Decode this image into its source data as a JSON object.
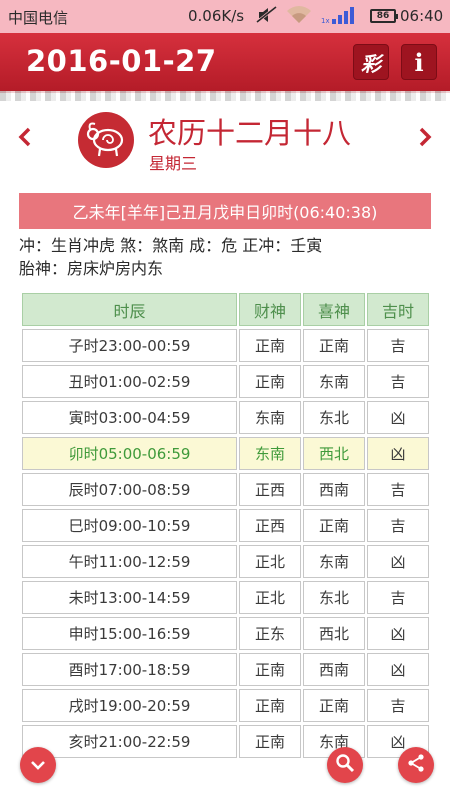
{
  "status": {
    "carrier": "中国电信",
    "speed": "0.06K/s",
    "battery": "86",
    "time": "06:40"
  },
  "header": {
    "date": "2016-01-27",
    "lottery_label": "彩",
    "info_label": "i"
  },
  "lunar": {
    "date": "农历十二月十八",
    "weekday": "星期三",
    "zodiac_icon": "goat-icon",
    "ganzhi": "乙未年[羊年]己丑月戊申日卯时(06:40:38)",
    "line1": "冲：生肖冲虎  煞：煞南  成：危  正冲：壬寅",
    "line2": "胎神：房床炉房内东"
  },
  "colors": {
    "accent": "#c42734",
    "good": "#3f9a3a"
  },
  "table": {
    "headers": [
      "时辰",
      "财神",
      "喜神",
      "吉时"
    ],
    "rows": [
      {
        "time": "子时23:00-00:59",
        "cai": "正南",
        "xi": "正南",
        "ji": "吉"
      },
      {
        "time": "丑时01:00-02:59",
        "cai": "正南",
        "xi": "东南",
        "ji": "吉"
      },
      {
        "time": "寅时03:00-04:59",
        "cai": "东南",
        "xi": "东北",
        "ji": "凶"
      },
      {
        "time": "卯时05:00-06:59",
        "cai": "东南",
        "xi": "西北",
        "ji": "凶"
      },
      {
        "time": "辰时07:00-08:59",
        "cai": "正西",
        "xi": "西南",
        "ji": "吉"
      },
      {
        "time": "巳时09:00-10:59",
        "cai": "正西",
        "xi": "正南",
        "ji": "吉"
      },
      {
        "time": "午时11:00-12:59",
        "cai": "正北",
        "xi": "东南",
        "ji": "凶"
      },
      {
        "time": "未时13:00-14:59",
        "cai": "正北",
        "xi": "东北",
        "ji": "吉"
      },
      {
        "time": "申时15:00-16:59",
        "cai": "正东",
        "xi": "西北",
        "ji": "凶"
      },
      {
        "time": "酉时17:00-18:59",
        "cai": "正南",
        "xi": "西南",
        "ji": "凶"
      },
      {
        "time": "戌时19:00-20:59",
        "cai": "正南",
        "xi": "正南",
        "ji": "吉"
      },
      {
        "time": "亥时21:00-22:59",
        "cai": "正南",
        "xi": "东南",
        "ji": "凶"
      }
    ]
  }
}
